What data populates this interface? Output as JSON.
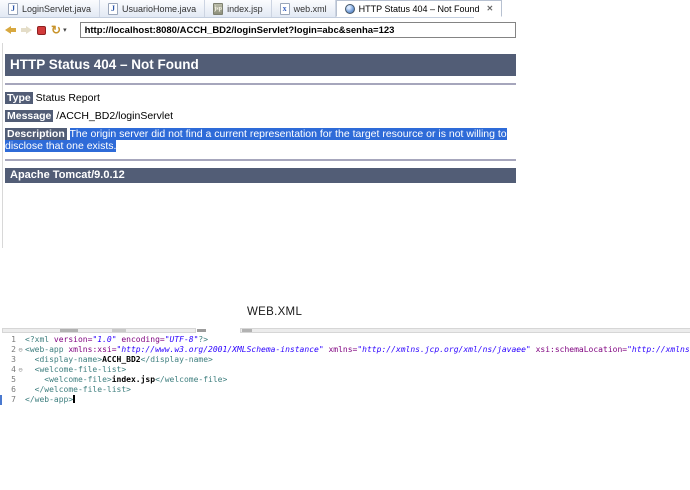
{
  "tabs": [
    {
      "label": "LoginServlet.java",
      "icon": "java-file-icon",
      "active": false
    },
    {
      "label": "UsuarioHome.java",
      "icon": "java-file-icon",
      "active": false
    },
    {
      "label": "index.jsp",
      "icon": "jsp-file-icon",
      "active": false
    },
    {
      "label": "web.xml",
      "icon": "xml-file-icon",
      "active": false
    },
    {
      "label": "HTTP Status 404 – Not Found",
      "icon": "globe-icon",
      "active": true,
      "close_glyph": "✕"
    }
  ],
  "tab_icon_glyphs": {
    "java": "J",
    "jsp": "jsp",
    "xml": "x"
  },
  "toolbar": {
    "url": "http://localhost:8080/ACCH_BD2/loginServlet?login=abc&senha=123",
    "refresh_glyph": "↻",
    "caret_glyph": "▾"
  },
  "error_page": {
    "title": "HTTP Status 404 – Not Found",
    "fields": [
      {
        "label": "Type",
        "value": "Status Report",
        "highlighted": false
      },
      {
        "label": "Message",
        "value": "/ACCH_BD2/loginServlet",
        "highlighted": false
      },
      {
        "label": "Description",
        "value": "The origin server did not find a current representation for the target resource or is not willing to disclose that one exists.",
        "highlighted": true
      }
    ],
    "footer": "Apache Tomcat/9.0.12"
  },
  "caption": "WEB.XML",
  "editor": {
    "fold_glyph": "⊖",
    "lines": [
      {
        "num": "1",
        "fold": false,
        "segments": [
          [
            "pi",
            "<?xml "
          ],
          [
            "attr",
            "version="
          ],
          [
            "str",
            "\"1.0\""
          ],
          [
            "attr",
            " encoding="
          ],
          [
            "str",
            "\"UTF-8\""
          ],
          [
            "pi",
            "?>"
          ]
        ]
      },
      {
        "num": "2",
        "fold": true,
        "segments": [
          [
            "tag",
            "<web-app "
          ],
          [
            "attr",
            "xmlns:xsi="
          ],
          [
            "str",
            "\"http://www.w3.org/2001/XMLSchema-instance\""
          ],
          [
            "attr",
            " xmlns="
          ],
          [
            "str",
            "\"http://xmlns.jcp.org/xml/ns/javaee\""
          ],
          [
            "attr",
            " xsi:schemaLocation="
          ],
          [
            "str",
            "\"http://xmlns.j"
          ]
        ]
      },
      {
        "num": "3",
        "fold": false,
        "segments": [
          [
            "tag",
            "  <display-name>"
          ],
          [
            "txt",
            "ACCH_BD2"
          ],
          [
            "tag",
            "</display-name>"
          ]
        ]
      },
      {
        "num": "4",
        "fold": true,
        "segments": [
          [
            "tag",
            "  <welcome-file-list>"
          ]
        ]
      },
      {
        "num": "5",
        "fold": false,
        "segments": [
          [
            "tag",
            "    <welcome-file>"
          ],
          [
            "txt",
            "index.jsp"
          ],
          [
            "tag",
            "</welcome-file>"
          ]
        ]
      },
      {
        "num": "6",
        "fold": false,
        "segments": [
          [
            "tag",
            "  </welcome-file-list>"
          ]
        ]
      },
      {
        "num": "7",
        "fold": false,
        "current": true,
        "cursor": true,
        "segments": [
          [
            "tag",
            "</web-app>"
          ]
        ]
      }
    ]
  },
  "colors": {
    "tomcat_header_bg": "#525D76",
    "selection_blue": "#2e6bd8",
    "xml_tag": "#3F7F7F",
    "xml_attribute": "#7F007F",
    "xml_string": "#2A00FF"
  }
}
